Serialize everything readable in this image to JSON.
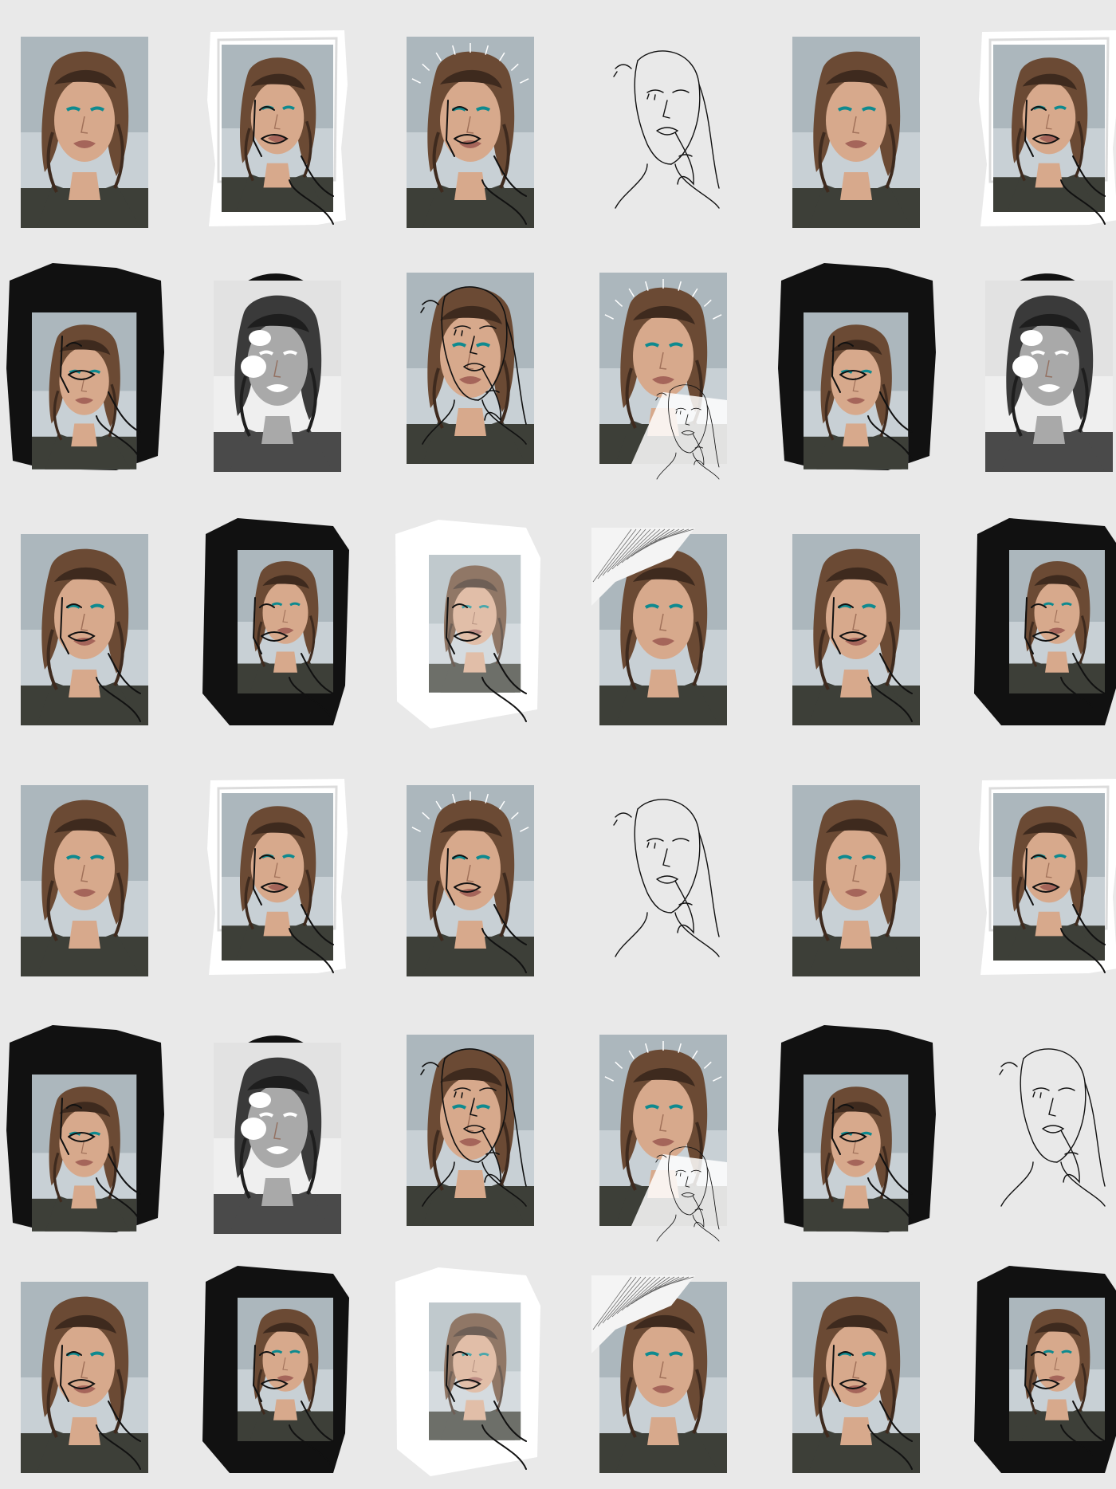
{
  "palette": {
    "background": "#e9e9e9",
    "photo_sky_top": "#9aa6ae",
    "photo_sky_bottom": "#c8d0d5",
    "hair": "#6b4a34",
    "hair_dark": "#3e2a1e",
    "skin": "#d7a98c",
    "skin_gray": "#a9a9a9",
    "jacket": "#3d3f38",
    "lips": "#a5655a",
    "eyeshadow": "#0e8a8f",
    "ink": "#111111",
    "paint_white": "#ffffff"
  },
  "grid": {
    "columns": 6,
    "rows": 6,
    "tiles": [
      [
        "photo",
        "photo-white-paint",
        "photo-halo-doodle",
        "line-drawing",
        "photo",
        "photo-white-paint"
      ],
      [
        "photo-black-paint",
        "grayscale-hood",
        "photo-closeup-doodle",
        "photo-halo-collage",
        "photo-black-paint",
        "grayscale-hood"
      ],
      [
        "photo-face-doodle",
        "photo-black-frame",
        "photo-white-frame",
        "photo-sketch-corner",
        "photo-face-doodle",
        "photo-black-frame"
      ],
      [
        "photo",
        "photo-white-paint",
        "photo-halo-doodle",
        "line-drawing",
        "photo",
        "photo-white-paint"
      ],
      [
        "photo-black-paint",
        "grayscale-hood",
        "photo-closeup-doodle",
        "photo-halo-collage",
        "photo-black-paint",
        "line-drawing"
      ],
      [
        "photo-face-doodle",
        "photo-black-frame",
        "photo-white-frame",
        "photo-sketch-corner",
        "photo-face-doodle",
        "photo-black-frame"
      ]
    ]
  }
}
